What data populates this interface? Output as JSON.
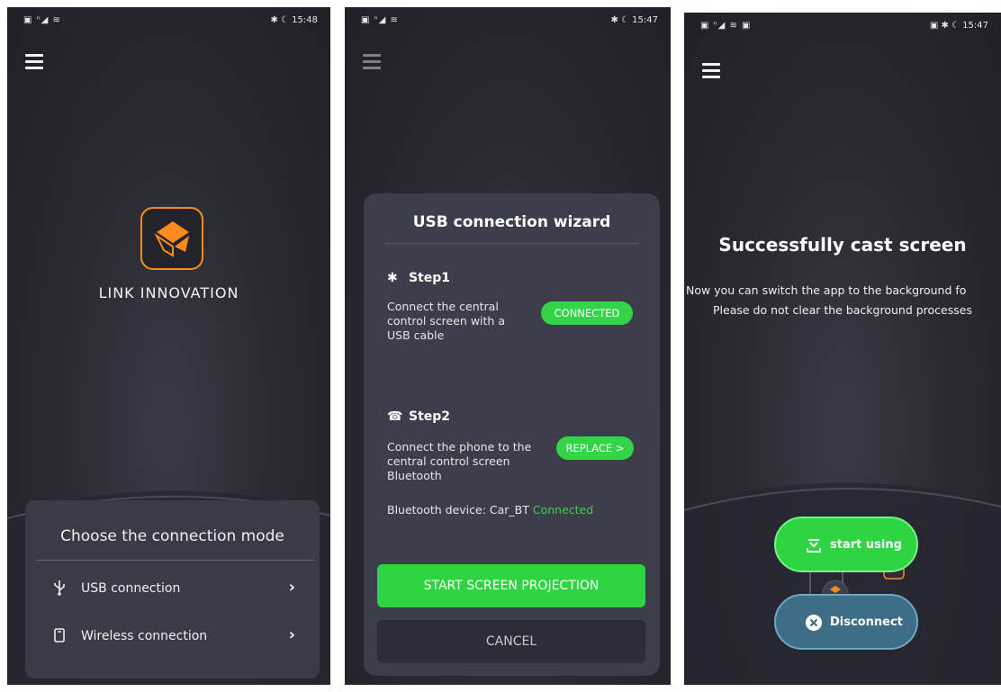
{
  "screen1": {
    "status": {
      "left": "▣ ⁿ◢ ≋",
      "right": "✱ ☾  15:48"
    },
    "brand_name": "LINK INNOVATION",
    "sheet": {
      "title": "Choose the connection mode",
      "options": [
        {
          "icon": "usb-icon",
          "label": "USB connection"
        },
        {
          "icon": "phone-icon",
          "label": "Wireless connection"
        }
      ],
      "chevron": "›"
    }
  },
  "screen2": {
    "status": {
      "left": "▣ ⁿ◢ ≋",
      "right": "✱ ☾  15:47"
    },
    "wizard": {
      "title": "USB connection wizard",
      "step1": {
        "icon": "bluetooth-icon",
        "heading": "Step1",
        "description": "Connect the central control screen with a USB cable",
        "status_label": "CONNECTED"
      },
      "step2": {
        "icon": "phone-wave-icon",
        "heading": "Step2",
        "description": "Connect the phone to the central control screen Bluetooth",
        "action_label": "REPLACE >",
        "device_prefix": "Bluetooth device: Car_BT",
        "device_status": "Connected"
      },
      "start_label": "START SCREEN PROJECTION",
      "cancel_label": "CANCEL"
    },
    "colors": {
      "accent": "#2ed541",
      "modal_bg": "#3d3e4b"
    }
  },
  "screen3": {
    "status": {
      "left": "▣ ⁿ◢ ≋ ▣",
      "right": "▣ ✱ ☾  15:47"
    },
    "title": "Successfully cast screen",
    "message_line1": "Now you can switch the app to the background fo",
    "message_line2": "Please do not clear the background processes",
    "start_label": "start using",
    "disconnect_label": "Disconnect"
  }
}
